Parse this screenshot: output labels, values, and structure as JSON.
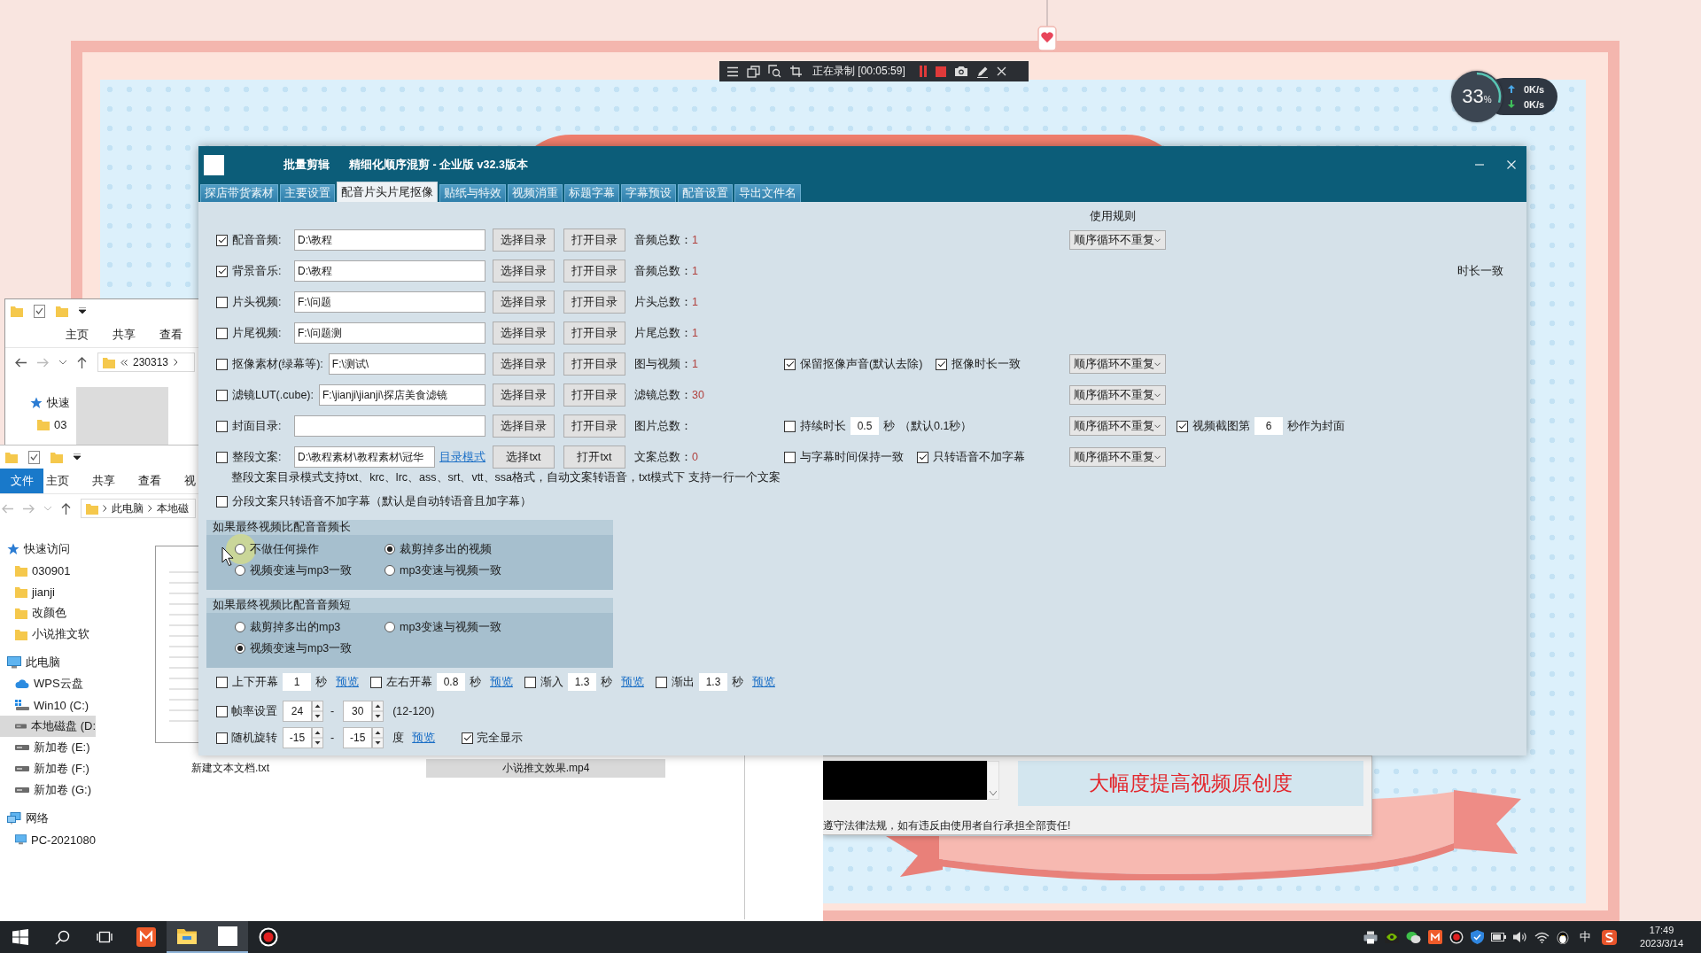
{
  "recorder_bar": {
    "status": "正在录制 [00:05:59]"
  },
  "speed_widget": {
    "percent": "33$_{%}$",
    "upload": "0K/s",
    "download": "0K/s"
  },
  "explorer_back": {
    "ribbon_tabs": [
      "主页",
      "共享",
      "查看"
    ],
    "path": [
      "230313"
    ],
    "nav": [
      {
        "label": "快速",
        "kind": "quick",
        "selected": false,
        "children": [
          {
            "label": "03",
            "kind": "folder",
            "selected": false
          }
        ]
      }
    ]
  },
  "explorer_front": {
    "file_menu": "文件",
    "ribbon_tabs": [
      "主页",
      "共享",
      "查看",
      "视"
    ],
    "path": [
      "此电脑",
      "本地磁"
    ],
    "nav": [
      {
        "label": "快速访问",
        "kind": "quick",
        "selected": false,
        "children": [
          {
            "label": "030901",
            "kind": "folder",
            "selected": false
          },
          {
            "label": "jianji",
            "kind": "folder",
            "selected": false
          },
          {
            "label": "改颜色",
            "kind": "folder",
            "selected": false
          },
          {
            "label": "小说推文软",
            "kind": "folder",
            "selected": false
          }
        ]
      },
      {
        "label": "此电脑",
        "kind": "pc",
        "selected": false,
        "children": [
          {
            "label": "WPS云盘",
            "kind": "cloud",
            "selected": false
          },
          {
            "label": "Win10 (C:)",
            "kind": "system-drive",
            "selected": false
          },
          {
            "label": "本地磁盘 (D:",
            "kind": "drive",
            "selected": true
          },
          {
            "label": "新加卷 (E:)",
            "kind": "drive",
            "selected": false
          },
          {
            "label": "新加卷 (F:)",
            "kind": "drive",
            "selected": false
          },
          {
            "label": "新加卷 (G:)",
            "kind": "drive",
            "selected": false
          }
        ]
      },
      {
        "label": "网络",
        "kind": "network",
        "selected": false,
        "children": [
          {
            "label": "PC-2021080",
            "kind": "pc",
            "selected": false
          }
        ]
      }
    ],
    "files": [
      {
        "name": "新建文本文档.txt",
        "selected": false
      },
      {
        "name": "小说推文效果.mp4",
        "selected": true
      }
    ]
  },
  "main_window": {
    "title": "批量剪辑",
    "subtitle": "精细化顺序混剪 - 企业版  v32.3版本",
    "tabs": [
      {
        "label": "探店带货素材",
        "selected": false
      },
      {
        "label": "主要设置",
        "selected": false
      },
      {
        "label": "配音片头片尾抠像",
        "selected": true
      },
      {
        "label": "贴纸与特效",
        "selected": false
      },
      {
        "label": "视频消重",
        "selected": false
      },
      {
        "label": "标题字幕",
        "selected": false
      },
      {
        "label": "字幕预设",
        "selected": false
      },
      {
        "label": "配音设置",
        "selected": false
      },
      {
        "label": "导出文件名",
        "selected": false
      }
    ],
    "rule_header": "使用规则",
    "rows": [
      {
        "checked": true,
        "label": "配音音频:",
        "path": "D:\\教程",
        "buttons": [
          "选择目录",
          "打开目录"
        ],
        "count_label": "音频总数：",
        "count": "1",
        "rule": "顺序循环不重复"
      },
      {
        "checked": true,
        "label": "背景音乐:",
        "path": "D:\\教程",
        "buttons": [
          "选择目录",
          "打开目录"
        ],
        "count_label": "音频总数：",
        "count": "1",
        "tail": "时长一致"
      },
      {
        "checked": false,
        "label": "片头视频:",
        "path": "F:\\问题",
        "buttons": [
          "选择目录",
          "打开目录"
        ],
        "count_label": "片头总数：",
        "count": "1"
      },
      {
        "checked": false,
        "label": "片尾视频:",
        "path": "F:\\问题测",
        "buttons": [
          "选择目录",
          "打开目录"
        ],
        "count_label": "片尾总数：",
        "count": "1"
      },
      {
        "checked": false,
        "label": "抠像素材(绿幕等):",
        "path": "F:\\测试\\",
        "buttons": [
          "选择目录",
          "打开目录"
        ],
        "count_label": "图与视频：",
        "count": "1",
        "middle": [
          {
            "kind": "check",
            "checked": true,
            "label": "保留抠像声音(默认去除)"
          },
          {
            "kind": "check",
            "checked": true,
            "label": "抠像时长一致"
          }
        ],
        "rule": "顺序循环不重复"
      },
      {
        "checked": false,
        "label": "滤镜LUT(.cube):",
        "path": "F:\\jianji\\jianji\\探店美食滤镜",
        "buttons": [
          "选择目录",
          "打开目录"
        ],
        "count_label": "滤镜总数：",
        "count": "30",
        "rule": "顺序循环不重复"
      },
      {
        "checked": false,
        "label": "封面目录:",
        "buttons": [
          "选择目录",
          "打开目录"
        ],
        "count_label": "图片总数：",
        "middle": [
          {
            "kind": "check",
            "checked": false,
            "label": "持续时长"
          },
          {
            "kind": "number",
            "value": "0.5"
          },
          {
            "kind": "text",
            "text": "秒"
          },
          {
            "kind": "text",
            "text": "（默认0.1秒）"
          }
        ],
        "rule": "顺序循环不重复",
        "extra": [
          {
            "kind": "check",
            "checked": true,
            "label": "视频截图第"
          },
          {
            "kind": "number",
            "value": "6"
          },
          {
            "kind": "text",
            "text": "秒作为封面"
          }
        ]
      },
      {
        "checked": false,
        "label": "整段文案:",
        "path": "D:\\教程素材\\教程素材\\冠华",
        "link": "目录模式",
        "buttons": [
          "选择txt",
          "打开txt"
        ],
        "count_label": "文案总数：",
        "count": "0",
        "middle": [
          {
            "kind": "check",
            "checked": false,
            "label": "与字幕时间保持一致"
          },
          {
            "kind": "check",
            "checked": true,
            "label": "只转语音不加字幕"
          }
        ],
        "rule": "顺序循环不重复"
      }
    ],
    "hint": "整段文案目录模式支持txt、krc、lrc、ass、srt、vtt、ssa格式，自动文案转语音，txt模式下 支持一行一个文案",
    "segment_option": {
      "checked": false,
      "label": "分段文案只转语音不加字幕（默认是自动转语音且加字幕）"
    },
    "radio_groups": [
      {
        "title": "如果最终视频比配音音频长",
        "options": [
          {
            "label": "不做任何操作",
            "selected": false
          },
          {
            "label": "裁剪掉多出的视频",
            "selected": true
          },
          {
            "label": "视频变速与mp3一致",
            "selected": false
          },
          {
            "label": "mp3变速与视频一致",
            "selected": false
          }
        ]
      },
      {
        "title": "如果最终视频比配音音频短",
        "options": [
          {
            "label": "裁剪掉多出的mp3",
            "selected": false
          },
          {
            "label": "mp3变速与视频一致",
            "selected": false
          },
          {
            "label": "视频变速与mp3一致",
            "selected": true
          }
        ]
      }
    ],
    "transitions": [
      {
        "checked": false,
        "label": "上下开幕",
        "value": "1",
        "unit": "秒",
        "link": "预览"
      },
      {
        "checked": false,
        "label": "左右开幕",
        "value": "0.8",
        "unit": "秒",
        "link": "预览"
      },
      {
        "checked": false,
        "label": "渐入",
        "value": "1.3",
        "unit": "秒",
        "link": "预览"
      },
      {
        "checked": false,
        "label": "渐出",
        "value": "1.3",
        "unit": "秒",
        "link": "预览"
      }
    ],
    "frame_rate": {
      "checked": false,
      "label": "帧率设置",
      "min": "24",
      "separator": "-",
      "max": "30",
      "range": "(12-120)"
    },
    "rotation": {
      "checked": false,
      "label": "随机旋转",
      "min": "-15",
      "separator": "-",
      "max": "-15",
      "unit": "度",
      "link": "预览"
    },
    "full_display": {
      "checked": true,
      "label": "完全显示"
    }
  },
  "banner_window": {
    "banner": "大幅度提高视频原创度",
    "disclaimer": "遵守法律法规，如有违反由使用者自行承担全部责任!"
  },
  "taskbar": {
    "apps": [
      {
        "kind": "orange-app",
        "open": false
      },
      {
        "kind": "explorer",
        "open": true
      },
      {
        "kind": "blank-app",
        "open": true
      },
      {
        "kind": "recorder",
        "open": false
      }
    ],
    "ime": "中",
    "time": "17:49",
    "date": "2023/3/14"
  }
}
